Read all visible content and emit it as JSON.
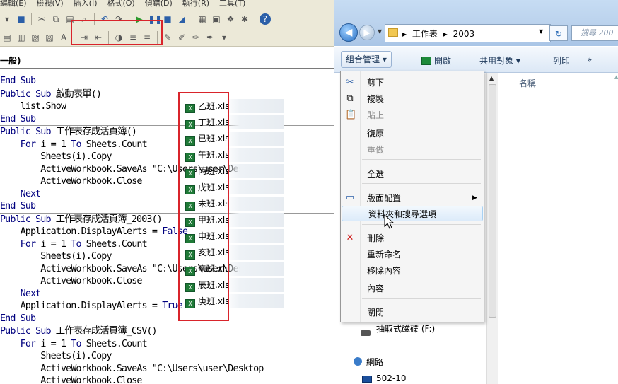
{
  "vba": {
    "menubar": [
      "編輯(E)",
      "檢視(V)",
      "插入(I)",
      "格式(O)",
      "偵錯(D)",
      "執行(R)",
      "工具(T)"
    ],
    "combo_label": "一般)",
    "code_lines": [
      "End Sub",
      "Public Sub 啟動表單()",
      "    list.Show",
      "End Sub",
      "Public Sub 工作表存成活頁簿()",
      "    For i = 1 To Sheets.Count",
      "        Sheets(i).Copy",
      "        ActiveWorkbook.SaveAs \"C:\\Users\\user\\Desktop",
      "        ActiveWorkbook.Close",
      "    Next",
      "End Sub",
      "Public Sub 工作表存成活頁簿_2003()",
      "    Application.DisplayAlerts = False",
      "    For i = 1 To Sheets.Count",
      "        Sheets(i).Copy",
      "        ActiveWorkbook.SaveAs \"C:\\Users\\user\\Desktop",
      "        ActiveWorkbook.Close",
      "    Next",
      "    Application.DisplayAlerts = True",
      "End Sub",
      "Public Sub 工作表存成活頁簿_CSV()",
      "    For i = 1 To Sheets.Count",
      "        Sheets(i).Copy",
      "        ActiveWorkbook.SaveAs \"C:\\Users\\user\\Desktop",
      "        ActiveWorkbook.Close"
    ],
    "separator_lines": [
      1,
      4,
      11,
      20
    ]
  },
  "explorer": {
    "breadcrumb": [
      "工作表",
      "2003"
    ],
    "search_placeholder": "搜尋 200",
    "cmdbar": {
      "organize": "組合管理 ▾",
      "open": "開啟",
      "share": "共用對象 ▾",
      "print": "列印",
      "more": "»"
    },
    "column_name": "名稱",
    "files": [
      "乙班.xls",
      "丁班.xls",
      "已班.xls",
      "午班.xls",
      "丙班.xls",
      "戊班.xls",
      "未班.xls",
      "甲班.xls",
      "申班.xls",
      "亥班.xls",
      "辛班.xls",
      "辰班.xls",
      "庚班.xls"
    ],
    "nav": {
      "drive": "抽取式磁碟 (F:)",
      "network": "網路",
      "pc": "502-10"
    }
  },
  "context_menu": {
    "items": [
      {
        "label": "剪下",
        "icon": "cut-icon",
        "glyph": "✂",
        "disabled": false
      },
      {
        "label": "複製",
        "icon": "copy-icon",
        "glyph": "⧉",
        "disabled": false
      },
      {
        "label": "貼上",
        "icon": "paste-icon",
        "glyph": "📋",
        "disabled": true
      },
      {
        "label": "復原",
        "icon": "",
        "glyph": "",
        "disabled": false
      },
      {
        "label": "重做",
        "icon": "",
        "glyph": "",
        "disabled": true
      },
      {
        "label": "全選",
        "icon": "",
        "glyph": "",
        "disabled": false
      },
      {
        "label": "版面配置",
        "icon": "layout-icon",
        "glyph": "▭",
        "disabled": false,
        "submenu": true
      },
      {
        "label": "資料夾和搜尋選項",
        "icon": "",
        "glyph": "",
        "disabled": false,
        "hover": true
      },
      {
        "label": "刪除",
        "icon": "delete-icon",
        "glyph": "✕",
        "disabled": false
      },
      {
        "label": "重新命名",
        "icon": "",
        "glyph": "",
        "disabled": false
      },
      {
        "label": "移除內容",
        "icon": "",
        "glyph": "",
        "disabled": false
      },
      {
        "label": "內容",
        "icon": "",
        "glyph": "",
        "disabled": false
      },
      {
        "label": "關閉",
        "icon": "",
        "glyph": "",
        "disabled": false
      }
    ]
  },
  "colors": {
    "highlight_red": "#d9242b",
    "vba_keyword": "#00007f",
    "delete_red": "#d02020"
  }
}
